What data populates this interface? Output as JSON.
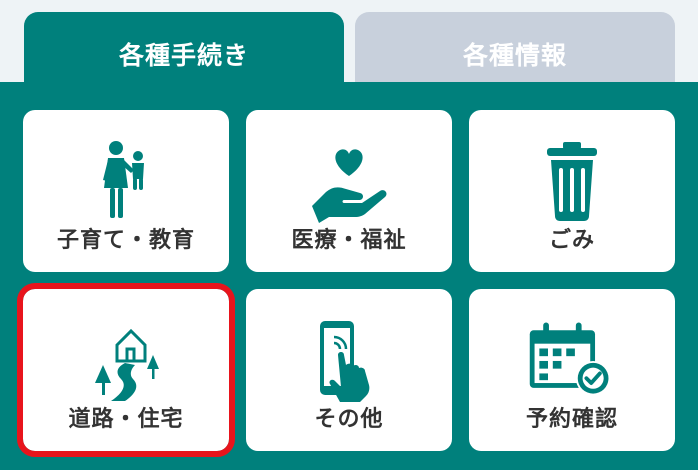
{
  "tabs": {
    "procedures": "各種手続き",
    "information": "各種情報"
  },
  "colors": {
    "primary": "#00807c",
    "inactive_tab": "#c8d0dc",
    "highlight": "#e8141c"
  },
  "cards": [
    {
      "label": "子育て・教育",
      "icon": "parent-child-icon"
    },
    {
      "label": "医療・福祉",
      "icon": "heart-hand-icon"
    },
    {
      "label": "ごみ",
      "icon": "trash-can-icon"
    },
    {
      "label": "道路・住宅",
      "icon": "house-road-icon"
    },
    {
      "label": "その他",
      "icon": "smartphone-touch-icon"
    },
    {
      "label": "予約確認",
      "icon": "calendar-check-icon"
    }
  ]
}
